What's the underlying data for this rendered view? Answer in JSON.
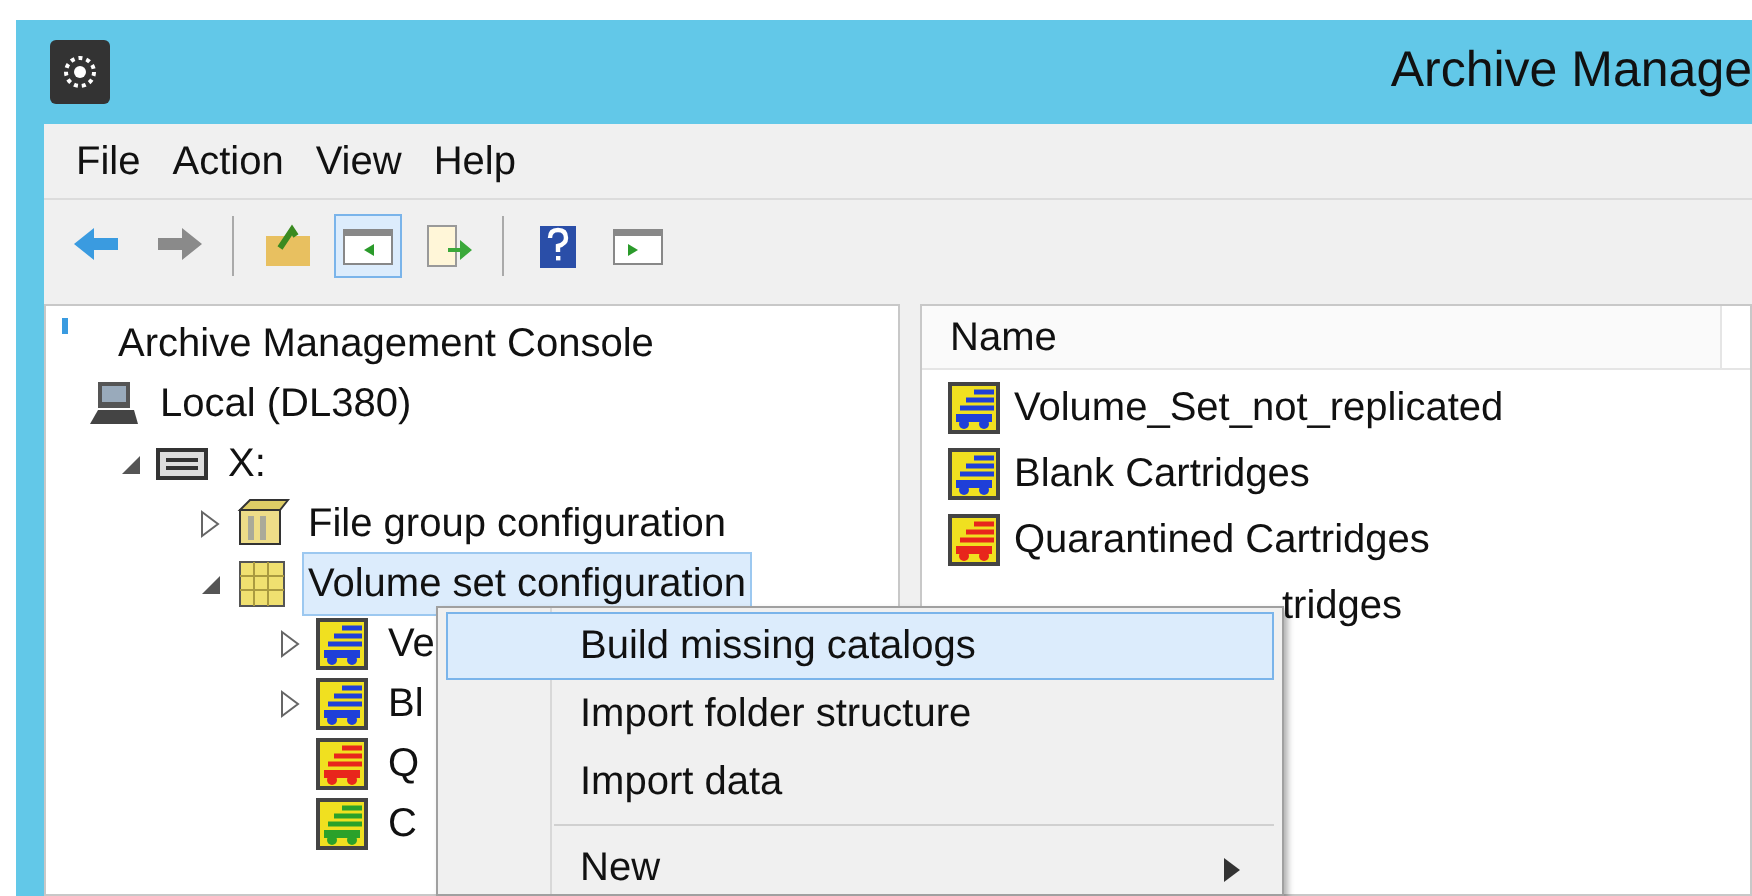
{
  "window": {
    "title": "Archive Manage"
  },
  "menu_bar": [
    {
      "label": "File"
    },
    {
      "label": "Action"
    },
    {
      "label": "View"
    },
    {
      "label": "Help"
    }
  ],
  "toolbar": [
    {
      "kind": "back"
    },
    {
      "kind": "forward"
    },
    {
      "kind": "separator"
    },
    {
      "kind": "up"
    },
    {
      "kind": "tree",
      "selected": true
    },
    {
      "kind": "export"
    },
    {
      "kind": "separator"
    },
    {
      "kind": "help"
    },
    {
      "kind": "action",
      "selected": false
    }
  ],
  "tree": [
    {
      "label": "Archive Management Console",
      "kind": "root",
      "selected": false,
      "children": [
        {
          "label": "Local (DL380)",
          "kind": "computer",
          "selected": false,
          "children": [
            {
              "label": "X:",
              "kind": "drive",
              "expanded": true,
              "selected": false,
              "children": [
                {
                  "label": "File group configuration",
                  "kind": "filegroup",
                  "expanded": false,
                  "selected": false
                },
                {
                  "label": "Volume set configuration",
                  "kind": "volumeset",
                  "expanded": true,
                  "selected": true,
                  "children": [
                    {
                      "label": "Ve",
                      "kind": "cartridge",
                      "color": "#1f3fd8",
                      "expanded": false,
                      "selected": false
                    },
                    {
                      "label": "Bl",
                      "kind": "cartridge",
                      "color": "#1f3fd8",
                      "expanded": false,
                      "selected": false
                    },
                    {
                      "label": "Q",
                      "kind": "cartridge",
                      "color": "#e8261c",
                      "selected": false
                    },
                    {
                      "label": "C",
                      "kind": "cartridge",
                      "color": "#2aa12a",
                      "selected": false
                    }
                  ]
                }
              ]
            }
          ]
        }
      ]
    }
  ],
  "list": {
    "columns": [
      {
        "label": "Name"
      }
    ],
    "rows": [
      {
        "name": "Volume_Set_not_replicated",
        "color": "#1f3fd8"
      },
      {
        "name": "Blank Cartridges",
        "color": "#1f3fd8"
      },
      {
        "name": "Quarantined Cartridges",
        "color": "#e8261c"
      },
      {
        "name": "tridges",
        "kind": "covered"
      }
    ]
  },
  "context_menu": [
    {
      "kind": "item",
      "label": "Build missing catalogs",
      "selected": true
    },
    {
      "kind": "item",
      "label": "Import folder structure",
      "selected": false
    },
    {
      "kind": "item",
      "label": "Import data",
      "selected": false
    },
    {
      "kind": "separator"
    },
    {
      "kind": "item",
      "label": "New",
      "selected": false,
      "submenu": true
    }
  ]
}
